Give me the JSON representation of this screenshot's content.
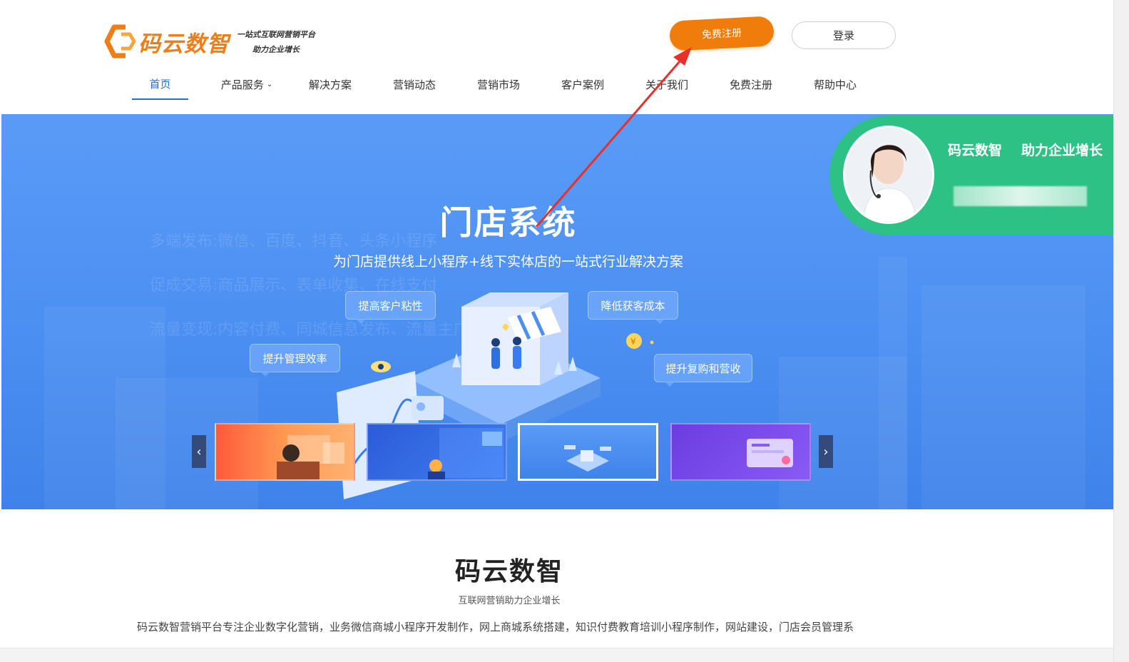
{
  "header": {
    "logo_name": "码云数智",
    "logo_tagline_1": "一站式互联网营销平台",
    "logo_tagline_2": "助力企业增长",
    "register_button": "免费注册",
    "login_button": "登录"
  },
  "nav": {
    "items": [
      {
        "label": "首页",
        "active": true
      },
      {
        "label": "产品服务",
        "has_dropdown": true
      },
      {
        "label": "解决方案"
      },
      {
        "label": "营销动态"
      },
      {
        "label": "营销市场"
      },
      {
        "label": "客户案例"
      },
      {
        "label": "关于我们"
      },
      {
        "label": "免费注册"
      },
      {
        "label": "帮助中心"
      }
    ]
  },
  "banner": {
    "title": "门店系统",
    "subtitle": "为门店提供线上小程序+线下实体店的一站式行业解决方案",
    "ghost_lines": [
      "多端发布:微信、百度、抖音、头条小程序",
      "促成交易:商品展示、表单收集、在线支付",
      "流量变现:内容付费、同城信息发布、流量主广告"
    ],
    "bubbles": [
      "提高客户粘性",
      "降低获客成本",
      "提升管理效率",
      "提升复购和营收"
    ],
    "prev_icon": "chevron-left-icon",
    "next_icon": "chevron-right-icon",
    "active_thumbnail": 3
  },
  "consult": {
    "brand": "码云数智",
    "slogan": "助力企业增长"
  },
  "section": {
    "title": "码云数智",
    "subtitle": "互联网营销助力企业增长",
    "description": "码云数智营销平台专注企业数字化营销，业务微信商城小程序开发制作，网上商城系统搭建，知识付费教育培训小程序制作，网站建设，门店会员管理系"
  },
  "colors": {
    "brand_orange": "#f07c0c",
    "nav_active": "#2b6bd6",
    "banner_blue": "#4b8ff2",
    "consult_green": "#2ec185",
    "annotation_red": "#e8302a"
  }
}
